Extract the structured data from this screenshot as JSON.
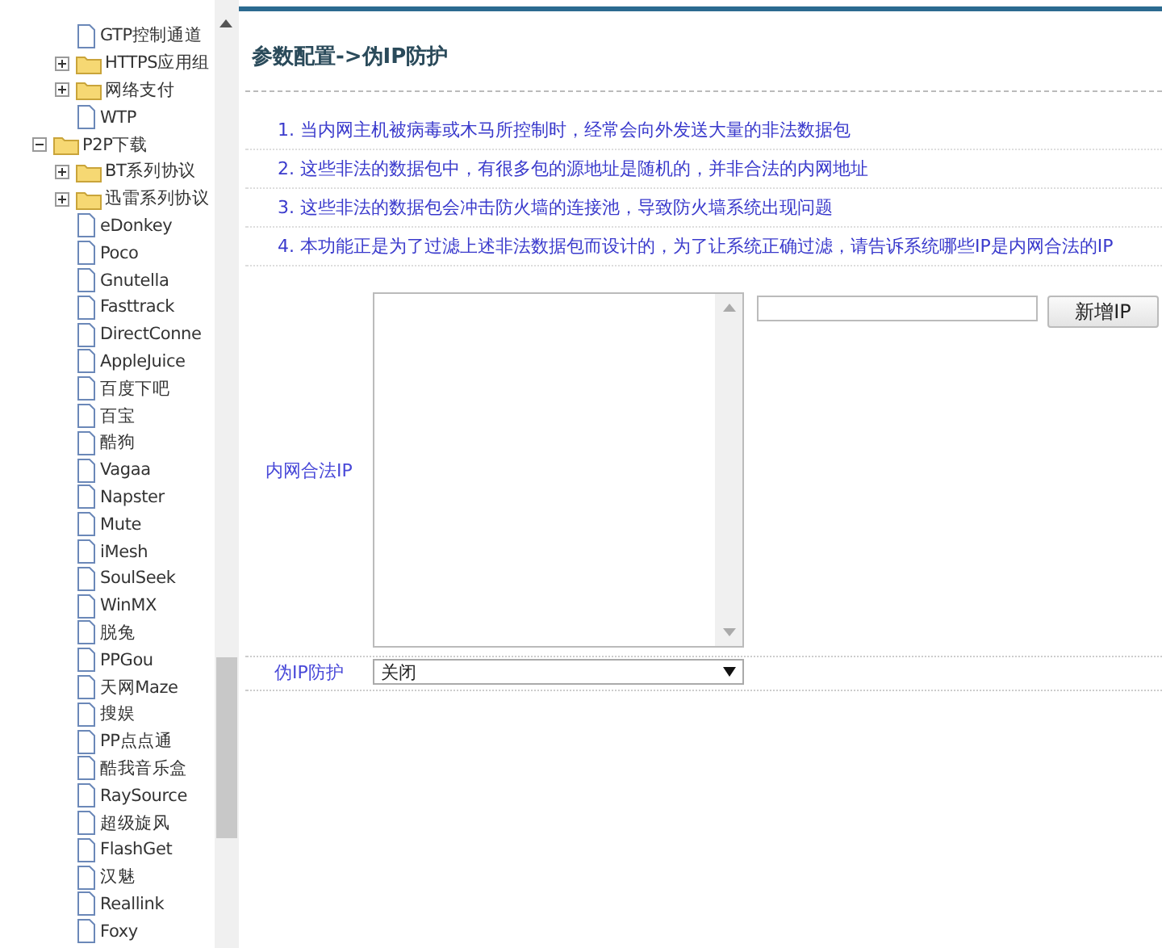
{
  "sidebar": {
    "continued_items": [
      {
        "label": "GTP控制通道",
        "kind": "file"
      },
      {
        "label": "HTTPS应用组",
        "kind": "folder",
        "expanded": false
      },
      {
        "label": "网络支付",
        "kind": "folder",
        "expanded": false
      },
      {
        "label": "WTP",
        "kind": "file"
      }
    ],
    "tree": [
      {
        "label": "P2P下载",
        "kind": "folder",
        "expanded": true,
        "children": [
          {
            "label": "BT系列协议",
            "kind": "folder",
            "expanded": false
          },
          {
            "label": "迅雷系列协议",
            "kind": "folder",
            "expanded": false
          },
          {
            "label": "eDonkey",
            "kind": "file"
          },
          {
            "label": "Poco",
            "kind": "file"
          },
          {
            "label": "Gnutella",
            "kind": "file"
          },
          {
            "label": "Fasttrack",
            "kind": "file"
          },
          {
            "label": "DirectConne",
            "kind": "file"
          },
          {
            "label": "AppleJuice",
            "kind": "file"
          },
          {
            "label": "百度下吧",
            "kind": "file"
          },
          {
            "label": "百宝",
            "kind": "file"
          },
          {
            "label": "酷狗",
            "kind": "file"
          },
          {
            "label": "Vagaa",
            "kind": "file"
          },
          {
            "label": "Napster",
            "kind": "file"
          },
          {
            "label": "Mute",
            "kind": "file"
          },
          {
            "label": "iMesh",
            "kind": "file"
          },
          {
            "label": "SoulSeek",
            "kind": "file"
          },
          {
            "label": "WinMX",
            "kind": "file"
          },
          {
            "label": "脱兔",
            "kind": "file"
          },
          {
            "label": "PPGou",
            "kind": "file"
          },
          {
            "label": "天网Maze",
            "kind": "file"
          },
          {
            "label": "搜娱",
            "kind": "file"
          },
          {
            "label": "PP点点通",
            "kind": "file"
          },
          {
            "label": "酷我音乐盒",
            "kind": "file"
          },
          {
            "label": "RaySource",
            "kind": "file"
          },
          {
            "label": "超级旋风",
            "kind": "file"
          },
          {
            "label": "FlashGet",
            "kind": "file"
          },
          {
            "label": "汉魅",
            "kind": "file"
          },
          {
            "label": "Reallink",
            "kind": "file"
          },
          {
            "label": "Foxy",
            "kind": "file"
          }
        ]
      }
    ]
  },
  "page_title": "参数配置->伪IP防护",
  "notes": [
    "1. 当内网主机被病毒或木马所控制时，经常会向外发送大量的非法数据包",
    "2. 这些非法的数据包中，有很多包的源地址是随机的，并非合法的内网地址",
    "3. 这些非法的数据包会冲击防火墙的连接池，导致防火墙系统出现问题",
    "4. 本功能正是为了过滤上述非法数据包而设计的，为了让系统正确过滤，请告诉系统哪些IP是内网合法的IP"
  ],
  "form": {
    "legal_ip": {
      "label": "内网合法IP",
      "add_button": "新增IP"
    },
    "protection": {
      "label": "伪IP防护",
      "value": "关闭"
    }
  }
}
